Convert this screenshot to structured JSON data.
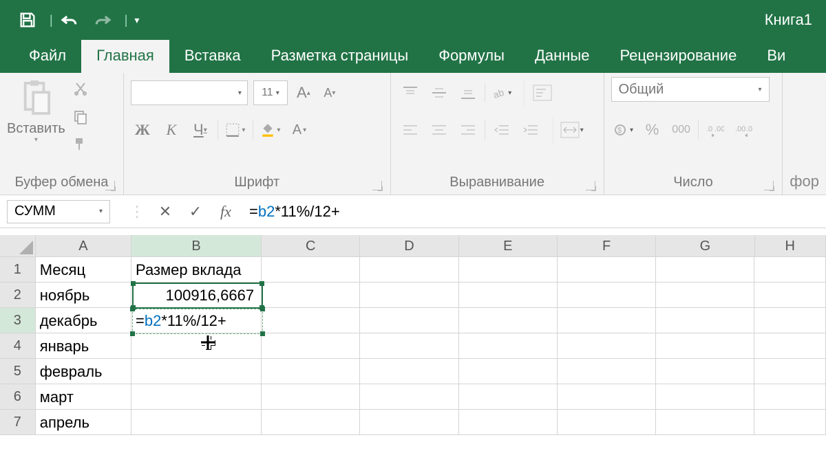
{
  "app": {
    "title": "Книга1"
  },
  "tabs": {
    "file": "Файл",
    "home": "Главная",
    "insert": "Вставка",
    "layout": "Разметка страницы",
    "formulas": "Формулы",
    "data": "Данные",
    "review": "Рецензирование",
    "view_partial": "Ви"
  },
  "ribbon": {
    "clipboard": {
      "paste": "Вставить",
      "label": "Буфер обмена"
    },
    "font": {
      "size": "11",
      "bold": "Ж",
      "italic": "К",
      "under": "Ч",
      "label": "Шрифт"
    },
    "alignment": {
      "label": "Выравнивание"
    },
    "number": {
      "format": "Общий",
      "label": "Число",
      "pct": "%",
      "thou": "000"
    },
    "format_partial": "фор"
  },
  "formula_bar": {
    "name_box": "СУММ",
    "fx": "fx",
    "formula_prefix": "=",
    "formula_ref": "b2",
    "formula_suffix": "*11%/12+"
  },
  "columns": [
    "A",
    "B",
    "C",
    "D",
    "E",
    "F",
    "G",
    "H"
  ],
  "rows": {
    "1": {
      "A": "Месяц",
      "B": "Размер вклада"
    },
    "2": {
      "A": "ноябрь",
      "B": "100916,6667"
    },
    "3": {
      "A": "декабрь",
      "B_prefix": "=",
      "B_ref": "b2",
      "B_suffix": "*11%/12+"
    },
    "4": {
      "A": "январь"
    },
    "5": {
      "A": "февраль"
    },
    "6": {
      "A": "март"
    },
    "7": {
      "A": "апрель"
    }
  }
}
